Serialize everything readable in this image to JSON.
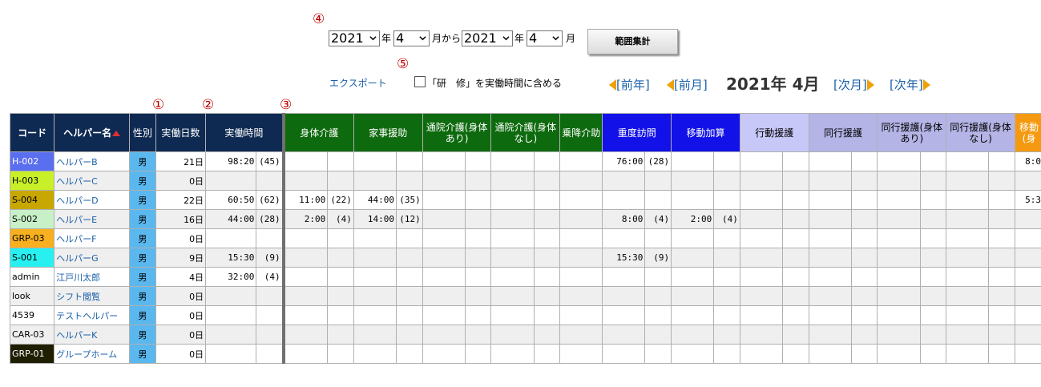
{
  "markers": {
    "m1": "①",
    "m2": "②",
    "m3": "③",
    "m4": "④",
    "m5": "⑤"
  },
  "range": {
    "from_year": "2021",
    "from_month": "4",
    "to_year": "2021",
    "to_month": "4",
    "year_label": "年",
    "from_suffix": "月から",
    "month_label": "月",
    "button": "範囲集計"
  },
  "export_label": "エクスポート",
  "training_checkbox_label": "「研　修」を実働時間に含める",
  "nav": {
    "prev_year": "[前年]",
    "prev_month": "[前月]",
    "current": "2021年 4月",
    "next_month": "[次月]",
    "next_year": "[次年]"
  },
  "headers": {
    "code": "コード",
    "name": "ヘルパー名",
    "sex": "性別",
    "days": "実働日数",
    "hours": "実働時間",
    "body_care": "身体介護",
    "housework": "家事援助",
    "visit_body": "通院介護(身体あり)",
    "visit_nobody": "通院介護(身体なし)",
    "ride": "乗降介助",
    "heavy": "重度訪問",
    "move_add": "移動加算",
    "behavior": "行動援護",
    "accompany": "同行援護",
    "acc_body": "同行援護(身体あり)",
    "acc_nobody": "同行援護(身体なし)",
    "moving": "移動(身"
  },
  "rows": [
    {
      "code": "H-002",
      "code_bg": "#5a6ef0",
      "code_fg": "#ffffff",
      "name": "ヘルパーB",
      "sex": "男",
      "days": "21日",
      "hours": "98:20",
      "hours_cnt": "(45)",
      "body": "",
      "body_cnt": "",
      "house": "",
      "house_cnt": "",
      "heavy": "76:00",
      "heavy_cnt": "(28)",
      "move": "",
      "move_cnt": "",
      "tail": "8:0"
    },
    {
      "code": "H-003",
      "code_bg": "#c8f028",
      "code_fg": "#000000",
      "name": "ヘルパーC",
      "sex": "男",
      "days": "0日",
      "hours": "",
      "hours_cnt": "",
      "body": "",
      "body_cnt": "",
      "house": "",
      "house_cnt": "",
      "heavy": "",
      "heavy_cnt": "",
      "move": "",
      "move_cnt": "",
      "tail": ""
    },
    {
      "code": "S-004",
      "code_bg": "#c8a800",
      "code_fg": "#000000",
      "name": "ヘルパーD",
      "sex": "男",
      "days": "22日",
      "hours": "60:50",
      "hours_cnt": "(62)",
      "body": "11:00",
      "body_cnt": "(22)",
      "house": "44:00",
      "house_cnt": "(35)",
      "heavy": "",
      "heavy_cnt": "",
      "move": "",
      "move_cnt": "",
      "tail": "5:3"
    },
    {
      "code": "S-002",
      "code_bg": "#c8f0c8",
      "code_fg": "#000000",
      "name": "ヘルパーE",
      "sex": "男",
      "days": "16日",
      "hours": "44:00",
      "hours_cnt": "(28)",
      "body": "2:00",
      "body_cnt": "(4)",
      "house": "14:00",
      "house_cnt": "(12)",
      "heavy": "8:00",
      "heavy_cnt": "(4)",
      "move": "2:00",
      "move_cnt": "(4)",
      "tail": ""
    },
    {
      "code": "GRP-03",
      "code_bg": "#f8b020",
      "code_fg": "#000000",
      "name": "ヘルパーF",
      "sex": "男",
      "days": "0日",
      "hours": "",
      "hours_cnt": "",
      "body": "",
      "body_cnt": "",
      "house": "",
      "house_cnt": "",
      "heavy": "",
      "heavy_cnt": "",
      "move": "",
      "move_cnt": "",
      "tail": ""
    },
    {
      "code": "S-001",
      "code_bg": "#28f0f0",
      "code_fg": "#000000",
      "name": "ヘルパーG",
      "sex": "男",
      "days": "9日",
      "hours": "15:30",
      "hours_cnt": "(9)",
      "body": "",
      "body_cnt": "",
      "house": "",
      "house_cnt": "",
      "heavy": "15:30",
      "heavy_cnt": "(9)",
      "move": "",
      "move_cnt": "",
      "tail": ""
    },
    {
      "code": "admin",
      "code_bg": "",
      "code_fg": "#000000",
      "name": "江戸川太郎",
      "sex": "男",
      "days": "4日",
      "hours": "32:00",
      "hours_cnt": "(4)",
      "body": "",
      "body_cnt": "",
      "house": "",
      "house_cnt": "",
      "heavy": "",
      "heavy_cnt": "",
      "move": "",
      "move_cnt": "",
      "tail": ""
    },
    {
      "code": "look",
      "code_bg": "",
      "code_fg": "#000000",
      "name": "シフト閲覧",
      "sex": "男",
      "days": "0日",
      "hours": "",
      "hours_cnt": "",
      "body": "",
      "body_cnt": "",
      "house": "",
      "house_cnt": "",
      "heavy": "",
      "heavy_cnt": "",
      "move": "",
      "move_cnt": "",
      "tail": ""
    },
    {
      "code": "4539",
      "code_bg": "",
      "code_fg": "#000000",
      "name": "テストヘルパー",
      "sex": "男",
      "days": "0日",
      "hours": "",
      "hours_cnt": "",
      "body": "",
      "body_cnt": "",
      "house": "",
      "house_cnt": "",
      "heavy": "",
      "heavy_cnt": "",
      "move": "",
      "move_cnt": "",
      "tail": ""
    },
    {
      "code": "CAR-03",
      "code_bg": "",
      "code_fg": "#000000",
      "name": "ヘルパーK",
      "sex": "男",
      "days": "0日",
      "hours": "",
      "hours_cnt": "",
      "body": "",
      "body_cnt": "",
      "house": "",
      "house_cnt": "",
      "heavy": "",
      "heavy_cnt": "",
      "move": "",
      "move_cnt": "",
      "tail": ""
    },
    {
      "code": "GRP-01",
      "code_bg": "#1e1e00",
      "code_fg": "#ffffff",
      "name": "グループホーム",
      "sex": "男",
      "days": "0日",
      "hours": "",
      "hours_cnt": "",
      "body": "",
      "body_cnt": "",
      "house": "",
      "house_cnt": "",
      "heavy": "",
      "heavy_cnt": "",
      "move": "",
      "move_cnt": "",
      "tail": ""
    }
  ]
}
